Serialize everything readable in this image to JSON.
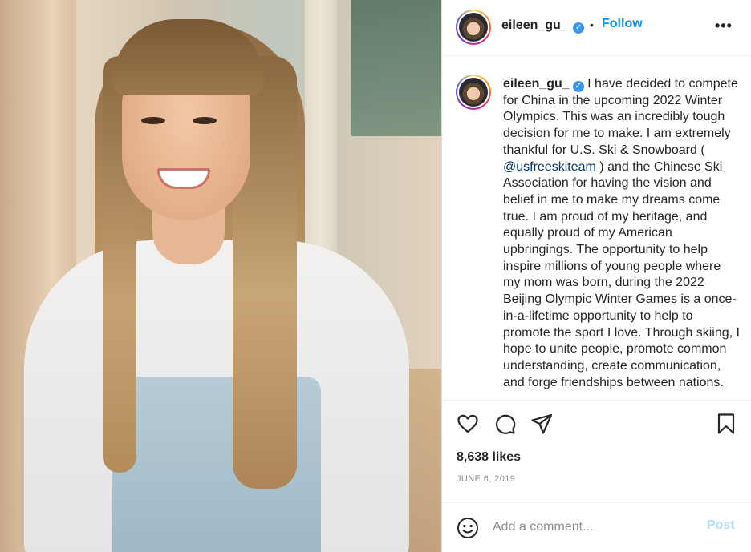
{
  "post": {
    "photo_alt": "eileen_gu_ photo",
    "header": {
      "username": "eileen_gu_",
      "verified_icon": "verified-badge-icon",
      "separator": "•",
      "follow_label": "Follow",
      "more_label": "•••"
    },
    "caption": {
      "username": "eileen_gu_",
      "text_1": "I have decided to compete for China in the upcoming 2022 Winter Olympics. This was an incredibly tough decision for me to make. I am extremely thankful for U.S. Ski & Snowboard ( ",
      "mention": "@usfreeskiteam",
      "text_2": " ) and the Chinese Ski Association for having the vision and belief in me to make my dreams come true. I am proud of my heritage, and equally proud of my American upbringings. The opportunity to help inspire millions of young people where my mom was born, during the 2022 Beijing Olympic Winter Games is a once-in-a-lifetime opportunity to help to promote the sport I love. Through skiing, I hope to unite people, promote common understanding, create communication, and forge friendships between nations."
    },
    "actions": {
      "like_icon": "heart-icon",
      "comment_icon": "comment-icon",
      "share_icon": "paper-plane-icon",
      "save_icon": "bookmark-icon"
    },
    "likes": "8,638 likes",
    "date": "JUNE 6, 2019",
    "add_comment": {
      "emoji_icon": "smiley-icon",
      "placeholder": "Add a comment...",
      "post_label": "Post"
    },
    "colors": {
      "link_blue": "#0095f6",
      "post_disabled": "#b2dffc",
      "verified_blue": "#3897f0",
      "mention": "#00376b",
      "muted": "#8e8e8e"
    }
  }
}
